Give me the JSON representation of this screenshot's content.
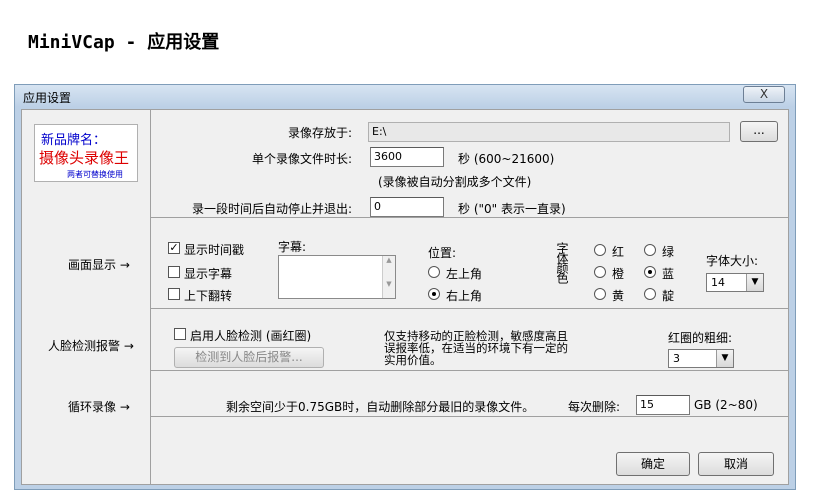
{
  "page_heading": "MiniVCap - 应用设置",
  "dialog": {
    "title": "应用设置",
    "close": "X"
  },
  "brand": {
    "line1": "新品牌名：",
    "line2": "摄像头录像王",
    "line3": "两者可替换使用"
  },
  "recording": {
    "save_label": "录像存放于:",
    "save_path": "E:\\",
    "browse": "...",
    "duration_label": "单个录像文件时长:",
    "duration_value": "3600",
    "duration_unit": "秒 (600~21600)",
    "split_note": "(录像被自动分割成多个文件)",
    "autostop_label": "录一段时间后自动停止并退出:",
    "autostop_value": "0",
    "autostop_unit": "秒 (\"0\" 表示一直录)"
  },
  "display": {
    "section": "画面显示 →",
    "show_timestamp": "显示时间戳",
    "show_subtitle": "显示字幕",
    "flip": "上下翻转",
    "subtitle_label": "字幕:",
    "position_label": "位置:",
    "pos_top_left": "左上角",
    "pos_top_right": "右上角",
    "font_color_label": "字体颜色",
    "colors": {
      "red": "红",
      "green": "绿",
      "orange": "橙",
      "blue": "蓝",
      "yellow": "黄",
      "indigo": "靛"
    },
    "font_size_label": "字体大小:",
    "font_size_value": "14"
  },
  "face": {
    "section": "人脸检测报警 →",
    "enable": "启用人脸检测 (画红圈)",
    "alarm_button": "检测到人脸后报警...",
    "note": "仅支持移动的正脸检测，敏感度高且误报率低，在适当的环境下有一定的实用价值。",
    "thickness_label": "红圈的粗细:",
    "thickness_value": "3"
  },
  "loop": {
    "section": "循环录像 →",
    "desc": "剩余空间少于0.75GB时，自动删除部分最旧的录像文件。",
    "delete_label": "每次删除:",
    "delete_value": "15",
    "delete_unit": "GB (2~80)"
  },
  "buttons": {
    "ok": "确定",
    "cancel": "取消"
  }
}
